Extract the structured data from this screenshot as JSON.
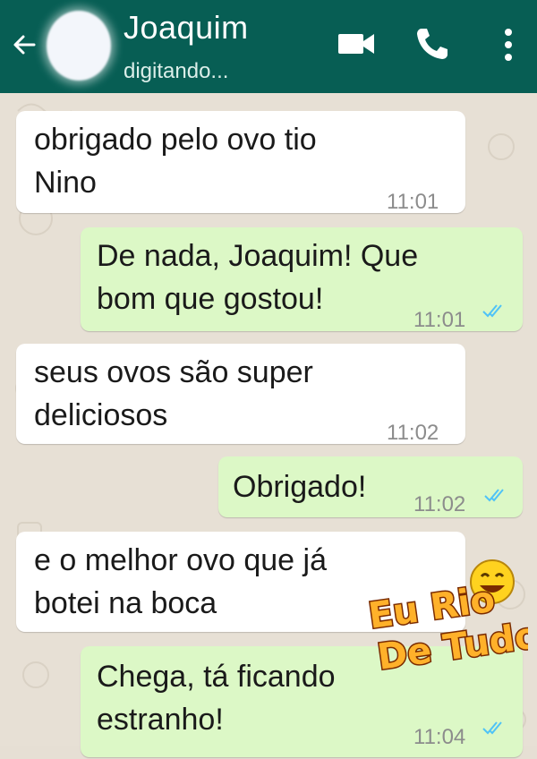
{
  "header": {
    "contact_name": "Joaquim",
    "status": "digitando...",
    "icons": [
      "back-arrow-icon",
      "avatar",
      "video-call-icon",
      "phone-icon",
      "more-vertical-icon"
    ]
  },
  "messages": [
    {
      "direction": "in",
      "lines": [
        "obrigado pelo ovo tio",
        "Nino"
      ],
      "time": "11:01"
    },
    {
      "direction": "out",
      "lines": [
        "De nada, Joaquim! Que",
        "bom que gostou!"
      ],
      "time": "11:01",
      "read": true
    },
    {
      "direction": "in",
      "lines": [
        "seus ovos são super",
        "deliciosos"
      ],
      "time": "11:02"
    },
    {
      "direction": "out",
      "lines": [
        "Obrigado!"
      ],
      "time": "11:02",
      "read": true
    },
    {
      "direction": "in",
      "lines": [
        "e o melhor ovo que já",
        "botei na boca"
      ]
    },
    {
      "direction": "out",
      "lines": [
        "Chega, tá ficando",
        "estranho!"
      ],
      "time": "11:04",
      "read": true
    }
  ],
  "watermark": {
    "line1": "Eu Rio",
    "line2": "De Tudo"
  },
  "colors": {
    "header": "#075e54",
    "incoming": "#ffffff",
    "outgoing": "#dcf8c6",
    "read_ticks": "#4fc3f7"
  }
}
